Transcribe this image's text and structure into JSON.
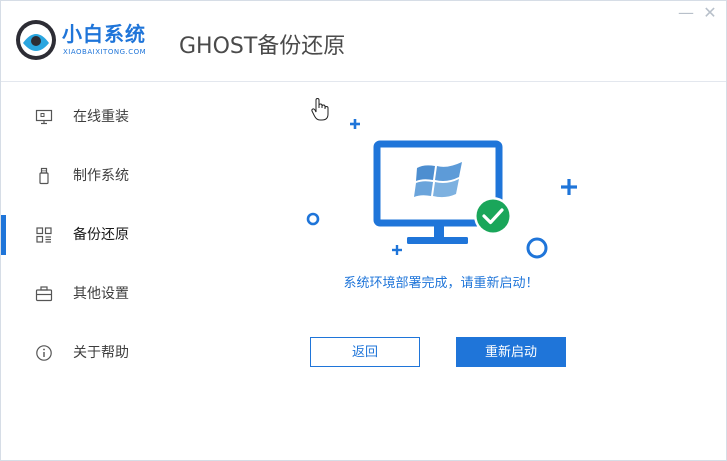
{
  "app": {
    "brand_name": "小白系统",
    "brand_sub": "XIAOBAIXITONG.COM",
    "page_title": "GHOST备份还原",
    "window_controls": {
      "minimize": "—",
      "close": "✕"
    }
  },
  "sidebar": {
    "items": [
      {
        "label": "在线重装",
        "icon": "monitor-icon"
      },
      {
        "label": "制作系统",
        "icon": "usb-icon"
      },
      {
        "label": "备份还原",
        "icon": "backup-grid-icon",
        "active": true
      },
      {
        "label": "其他设置",
        "icon": "briefcase-icon"
      },
      {
        "label": "关于帮助",
        "icon": "info-icon"
      }
    ]
  },
  "main": {
    "status": "系统环境部署完成，请重新启动！",
    "back_label": "返回",
    "restart_label": "重新启动"
  },
  "colors": {
    "accent": "#1f75d9",
    "success": "#1aa65a"
  }
}
